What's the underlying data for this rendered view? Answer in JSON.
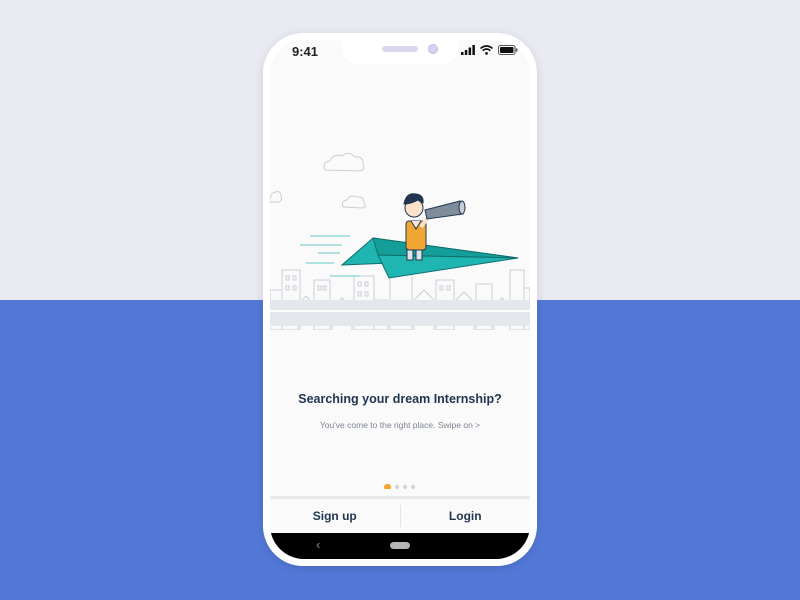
{
  "status_bar": {
    "time": "9:41",
    "icons": [
      "signal-icon",
      "wifi-icon",
      "battery-icon"
    ]
  },
  "onboarding": {
    "illustration": "person-with-telescope-on-paper-plane-over-city",
    "headline": "Searching your dream Internship?",
    "subline": "You've come to the right place. Swipe on >",
    "page_count": 4,
    "active_page": 1
  },
  "actions": {
    "signup_label": "Sign up",
    "login_label": "Login"
  },
  "nav_bar": {
    "back_icon": "back-chevron-icon",
    "home_icon": "home-pill-icon"
  },
  "colors": {
    "background_top": "#e9eaf2",
    "background_bottom": "#5279d7",
    "text_primary": "#1f3550",
    "accent_orange": "#f2a634",
    "plane_teal": "#1fb5b0"
  }
}
